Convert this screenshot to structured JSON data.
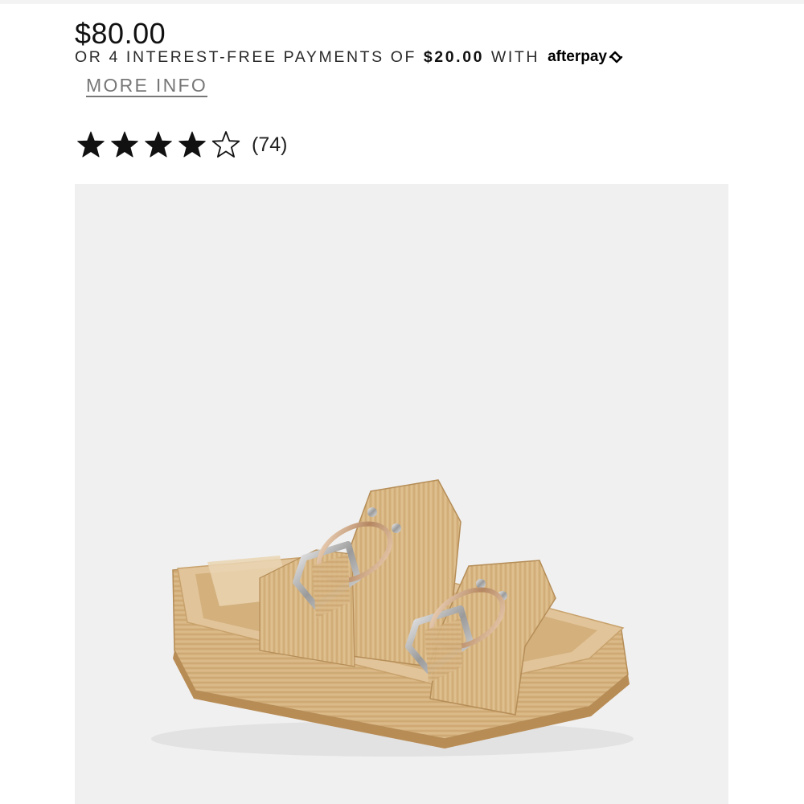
{
  "product": {
    "price": "$80.00",
    "rating_value": 4,
    "rating_max": 5,
    "review_count": "(74)",
    "image_alt_semantic": "platform-slide-sandal-image"
  },
  "afterpay": {
    "prefix": "OR 4 INTEREST-FREE PAYMENTS OF",
    "installment": "$20.00",
    "suffix": "WITH",
    "logo_text": "afterpay",
    "more_info_label": "MORE INFO"
  },
  "colors": {
    "background": "#ffffff",
    "image_background": "#f0f0f0",
    "star_fill": "#111111",
    "raffia": "#d9b784",
    "link_gray": "#777777"
  }
}
